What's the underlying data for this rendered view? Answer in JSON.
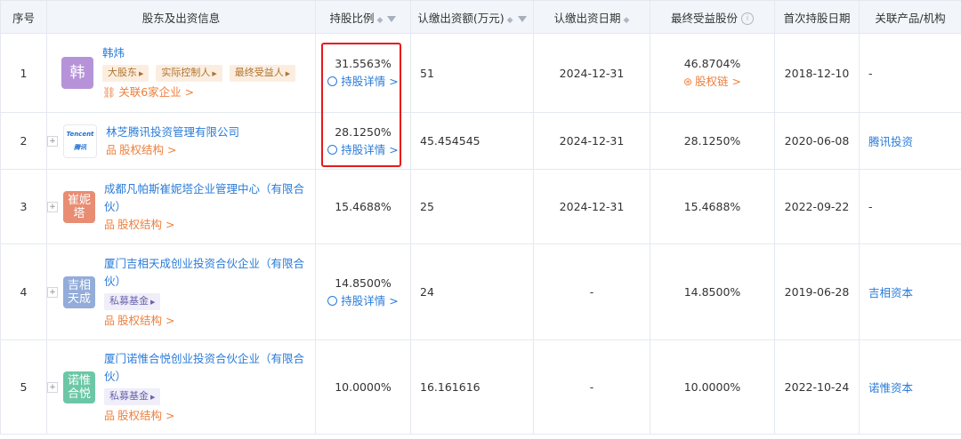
{
  "headers": {
    "index": "序号",
    "holder": "股东及出资信息",
    "ratio": "持股比例",
    "amount": "认缴出资额(万元)",
    "date": "认缴出资日期",
    "final": "最终受益股份",
    "first": "首次持股日期",
    "product": "关联产品/机构"
  },
  "colors": {
    "link": "#2a7bd8",
    "orange": "#ef7f3c",
    "highlight": "#e8191b"
  },
  "rows": [
    {
      "index": "1",
      "logo": "韩",
      "logo_color": "#b693d9",
      "name": "韩炜",
      "tags": [
        "大股东",
        "实际控制人",
        "最终受益人"
      ],
      "tag_style": "orange",
      "link": "关联6家企业 >",
      "link_icon": "relation-icon",
      "ratio": "31.5563%",
      "detail": "持股详情 >",
      "amount": "51",
      "date": "2024-12-31",
      "final": "46.8704%",
      "final_link": "股权链 >",
      "first": "2018-12-10",
      "product": "-"
    },
    {
      "index": "2",
      "logo": "Tencent 腾讯",
      "logo_color": "#ffffff",
      "name": "林芝腾讯投资管理有限公司",
      "tags": [],
      "link": "股权结构 >",
      "link_icon": "structure-icon",
      "ratio": "28.1250%",
      "detail": "持股详情 >",
      "amount": "45.454545",
      "date": "2024-12-31",
      "final": "28.1250%",
      "final_link": "",
      "first": "2020-06-08",
      "product": "腾讯投资"
    },
    {
      "index": "3",
      "logo": "崔妮塔",
      "logo_color": "#e88d73",
      "name": "成都凡帕斯崔妮塔企业管理中心（有限合伙）",
      "tags": [],
      "link": "股权结构 >",
      "link_icon": "structure-icon",
      "ratio": "15.4688%",
      "detail": "",
      "amount": "25",
      "date": "2024-12-31",
      "final": "15.4688%",
      "final_link": "",
      "first": "2022-09-22",
      "product": "-"
    },
    {
      "index": "4",
      "logo": "吉相天成",
      "logo_color": "#93acd9",
      "name": "厦门吉相天成创业投资合伙企业（有限合伙）",
      "tags": [
        "私募基金"
      ],
      "tag_style": "purple",
      "link": "股权结构 >",
      "link_icon": "structure-icon",
      "ratio": "14.8500%",
      "detail": "持股详情 >",
      "amount": "24",
      "date": "-",
      "final": "14.8500%",
      "final_link": "",
      "first": "2019-06-28",
      "product": "吉相资本"
    },
    {
      "index": "5",
      "logo": "诺惟合悦",
      "logo_color": "#6cc7a6",
      "name": "厦门诺惟合悦创业投资合伙企业（有限合伙）",
      "tags": [
        "私募基金"
      ],
      "tag_style": "purple",
      "link": "股权结构 >",
      "link_icon": "structure-icon",
      "ratio": "10.0000%",
      "detail": "",
      "amount": "16.161616",
      "date": "-",
      "final": "10.0000%",
      "final_link": "",
      "first": "2022-10-24",
      "product": "诺惟资本"
    }
  ]
}
